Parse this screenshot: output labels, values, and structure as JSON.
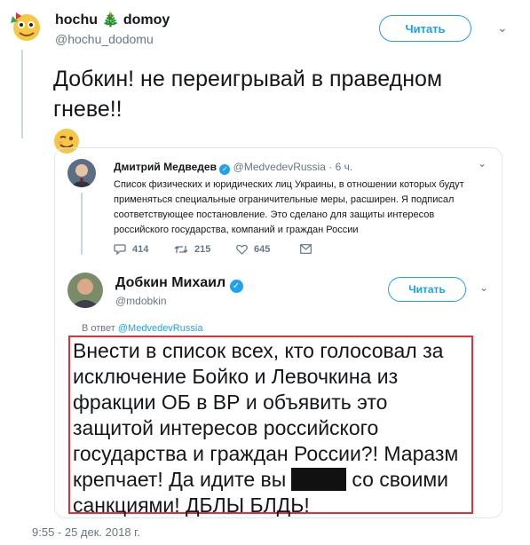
{
  "main_tweet": {
    "display_name": "hochu",
    "display_name_2": "domoy",
    "handle": "@hochu_dodomu",
    "follow_label": "Читать",
    "text": "Добкин! не переигрывай в праведном гневе!!",
    "timestamp": "9:55 - 25 дек. 2018 г."
  },
  "quoted_tweet": {
    "display_name": "Дмитрий Медведев",
    "handle": "@MedvedevRussia",
    "separator": "·",
    "time": "6 ч.",
    "text": "Список физических и юридических лиц Украины, в отношении которых будут применяться специальные ограничительные меры, расширен. Я подписал соответствующее постановление. Это сделано для защиты интересов российского государства, компаний и граждан России",
    "replies": "414",
    "retweets": "215",
    "likes": "645"
  },
  "reply_tweet": {
    "display_name": "Добкин Михаил",
    "handle": "@mdobkin",
    "follow_label": "Читать",
    "reply_to_prefix": "В ответ",
    "reply_to_handle": "@MedvedevRussia",
    "text_part1": "Внести в список всех, кто голосовал за исключение Бойко и Левочкина из фракции ОБ в ВР и объявить это защитой интересов российского государства и граждан России?! Маразм крепчает! Да идите вы",
    "text_part2": "со своими санкциями! ДБЛЫ БЛДЬ!"
  },
  "colors": {
    "accent": "#1da1f2",
    "highlight_border": "#e0303a",
    "secondary_text": "#657786"
  }
}
